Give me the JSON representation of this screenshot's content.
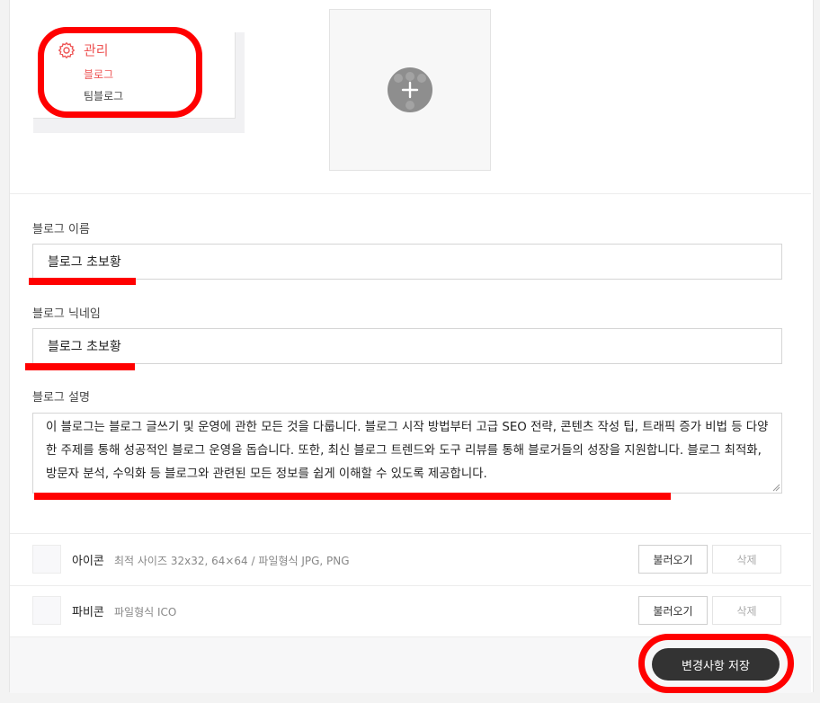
{
  "menu": {
    "title": "관리",
    "sub_items": [
      "블로그",
      "팀블로그"
    ]
  },
  "upload": {
    "icon": "plus-icon"
  },
  "form": {
    "name_label": "블로그 이름",
    "name_value": "블로그 초보황",
    "nickname_label": "블로그 닉네임",
    "nickname_value": "블로그 초보황",
    "desc_label": "블로그 설명",
    "desc_value": "이 블로그는 블로그 글쓰기 및 운영에 관한 모든 것을 다룹니다. 블로그 시작 방법부터 고급 SEO 전략, 콘텐츠 작성 팁, 트래픽 증가 비법 등 다양한 주제를 통해 성공적인 블로그 운영을 돕습니다. 또한, 최신 블로그 트렌드와 도구 리뷰를 통해 블로거들의 성장을 지원합니다. 블로그 최적화, 방문자 분석, 수익화 등 블로그와 관련된 모든 정보를 쉽게 이해할 수 있도록 제공합니다."
  },
  "icon_row": {
    "title": "아이콘",
    "desc": "최적 사이즈 32x32, 64×64 / 파일형식 JPG, PNG",
    "load_label": "불러오기",
    "delete_label": "삭제"
  },
  "favicon_row": {
    "title": "파비콘",
    "desc": "파일형식 ICO",
    "load_label": "불러오기",
    "delete_label": "삭제"
  },
  "save_label": "변경사항 저장",
  "colors": {
    "accent": "#ee5555",
    "highlight": "#ff0000",
    "save_button": "#333333"
  }
}
